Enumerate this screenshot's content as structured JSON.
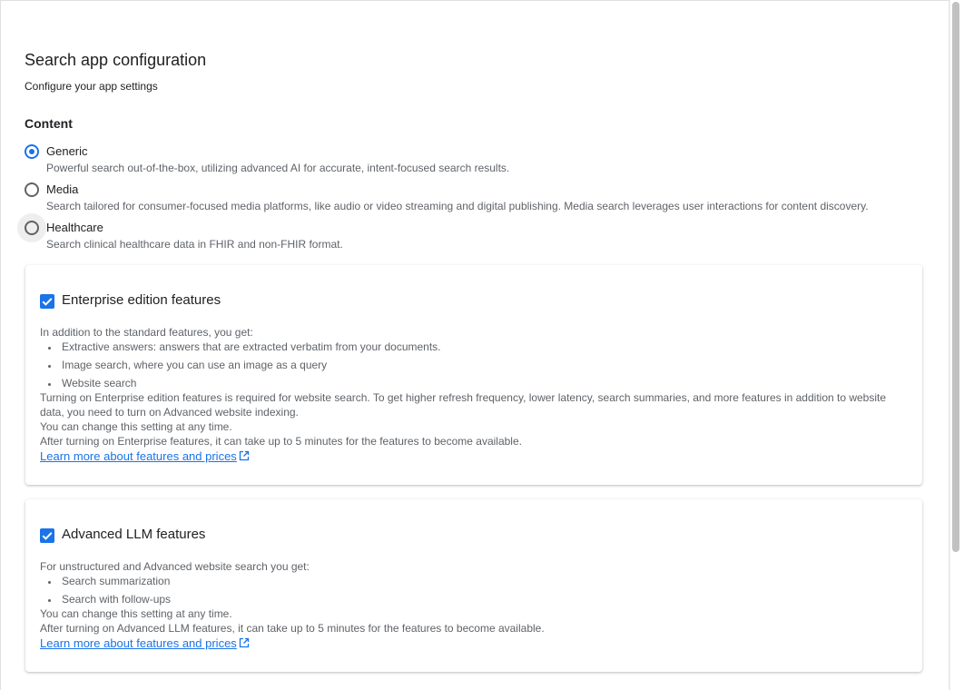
{
  "page": {
    "title": "Search app configuration",
    "subtitle": "Configure your app settings"
  },
  "content": {
    "heading": "Content",
    "selected": "Generic",
    "options": [
      {
        "label": "Generic",
        "description": "Powerful search out-of-the-box, utilizing advanced AI for accurate, intent-focused search results.",
        "checked": true
      },
      {
        "label": "Media",
        "description": "Search tailored for consumer-focused media platforms, like audio or video streaming and digital publishing. Media search leverages user interactions for content discovery.",
        "checked": false
      },
      {
        "label": "Healthcare",
        "description": "Search clinical healthcare data in FHIR and non-FHIR format.",
        "checked": false
      }
    ]
  },
  "enterprise": {
    "title": "Enterprise edition features",
    "checked": true,
    "intro": "In addition to the standard features, you get:",
    "features": [
      "Extractive answers: answers that are extracted verbatim from your documents.",
      "Image search, where you can use an image as a query",
      "Website search"
    ],
    "note": "Turning on Enterprise edition features is required for website search. To get higher refresh frequency, lower latency, search summaries, and more features in addition to website data, you need to turn on Advanced website indexing.",
    "change_note": "You can change this setting at any time.",
    "availability_note": "After turning on Enterprise features, it can take up to 5 minutes for the features to become available.",
    "link": "Learn more about features and prices"
  },
  "llm": {
    "title": "Advanced LLM features",
    "checked": true,
    "intro": "For unstructured and Advanced website search you get:",
    "features": [
      "Search summarization",
      "Search with follow-ups"
    ],
    "change_note": "You can change this setting at any time.",
    "availability_note": "After turning on Advanced LLM features, it can take up to 5 minutes for the features to become available.",
    "link": "Learn more about features and prices"
  },
  "colors": {
    "accent": "#1a73e8",
    "text_primary": "#202124",
    "text_secondary": "#5f6368"
  },
  "icons": {
    "external_link": "open-in-new-icon",
    "checkbox": "check-icon"
  }
}
